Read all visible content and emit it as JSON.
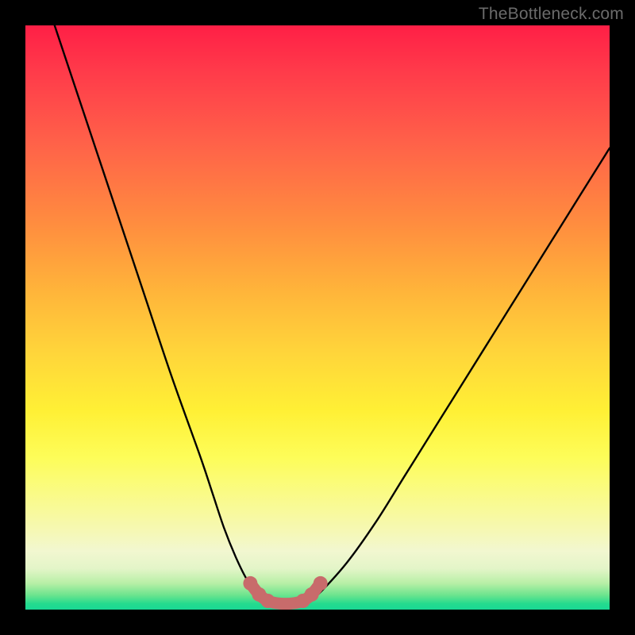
{
  "attribution": "TheBottleneck.com",
  "colors": {
    "background": "#000000",
    "gradient_top": "#ff1f46",
    "gradient_mid": "#fff035",
    "gradient_bottom": "#1ad894",
    "curve_stroke": "#000000",
    "marker_stroke": "#c86b6b",
    "attribution_text": "#6b6b6b"
  },
  "chart_data": {
    "type": "line",
    "title": "",
    "xlabel": "",
    "ylabel": "",
    "xlim": [
      0,
      100
    ],
    "ylim": [
      0,
      100
    ],
    "series": [
      {
        "name": "bottleneck-curve",
        "x": [
          5,
          10,
          15,
          20,
          25,
          30,
          32,
          34,
          36,
          38,
          40,
          42,
          44,
          46,
          48,
          50,
          55,
          60,
          65,
          70,
          75,
          80,
          85,
          90,
          95,
          100
        ],
        "y": [
          100,
          85,
          70,
          55,
          40,
          26,
          20,
          14,
          9,
          5,
          2.5,
          1.3,
          1,
          1,
          1.3,
          2.5,
          8,
          15,
          23,
          31,
          39,
          47,
          55,
          63,
          71,
          79
        ]
      }
    ],
    "markers": {
      "name": "sweet-spot",
      "x": [
        38.5,
        40,
        41.5,
        43,
        44.5,
        46,
        47.5,
        49,
        50.5
      ],
      "y": [
        4.5,
        2.6,
        1.5,
        1.1,
        1.0,
        1.1,
        1.5,
        2.6,
        4.5
      ]
    }
  }
}
